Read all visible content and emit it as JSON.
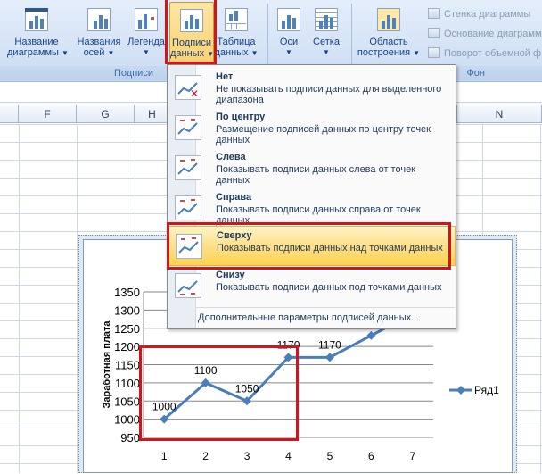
{
  "ribbon": {
    "buttons": [
      {
        "line1": "Название",
        "line2": "диаграммы",
        "name": "chart-title"
      },
      {
        "line1": "Названия",
        "line2": "осей",
        "name": "axis-titles"
      },
      {
        "line1": "Легенда",
        "line2": "",
        "name": "legend"
      },
      {
        "line1": "Подписи",
        "line2": "данных",
        "name": "data-labels"
      },
      {
        "line1": "Таблица",
        "line2": "данных",
        "name": "data-table"
      },
      {
        "line1": "Оси",
        "line2": "",
        "name": "axes"
      },
      {
        "line1": "Сетка",
        "line2": "",
        "name": "gridlines"
      },
      {
        "line1": "Область",
        "line2": "построения",
        "name": "plot-area"
      }
    ],
    "groups": {
      "labels": "Подписи",
      "background": "Фон"
    },
    "small_commands": [
      "Стенка диаграммы",
      "Основание диаграмм",
      "Поворот объемной ф"
    ]
  },
  "sheet": {
    "columns": [
      "F",
      "G",
      "H",
      "N"
    ]
  },
  "menu": {
    "items": [
      {
        "title": "Нет",
        "desc": "Не показывать подписи данных для выделенного диапазона"
      },
      {
        "title": "По центру",
        "desc": "Размещение подписей данных по центру точек данных"
      },
      {
        "title": "Слева",
        "desc": "Показывать подписи данных слева от точек данных"
      },
      {
        "title": "Справа",
        "desc": "Показывать подписи данных справа от точек данных"
      },
      {
        "title": "Сверху",
        "desc": "Показывать подписи данных над точками данных"
      },
      {
        "title": "Снизу",
        "desc": "Показывать подписи данных под точками данных"
      }
    ],
    "more_options": "Дополнительные параметры подписей данных...",
    "highlighted_index": 4
  },
  "chart_data": {
    "type": "line",
    "categories": [
      "1",
      "2",
      "3",
      "4",
      "5",
      "6",
      "7"
    ],
    "series": [
      {
        "name": "Ряд1",
        "values": [
          1000,
          1100,
          1050,
          1170,
          1170,
          1230,
          1290
        ]
      }
    ],
    "data_labels": [
      "1000",
      "1100",
      "1050",
      "1170",
      "1170"
    ],
    "ylabel": "Заработная плата",
    "yticks": [
      "950",
      "1000",
      "1050",
      "1100",
      "1150",
      "1200",
      "1250",
      "1300",
      "1350"
    ],
    "ylim": [
      950,
      1350
    ],
    "grid": true,
    "legend_position": "right",
    "color": "#4a7ebb"
  },
  "colors": {
    "highlight": "#ffd24f",
    "annotation": "#d4141b",
    "series": "#4a7ebb"
  }
}
